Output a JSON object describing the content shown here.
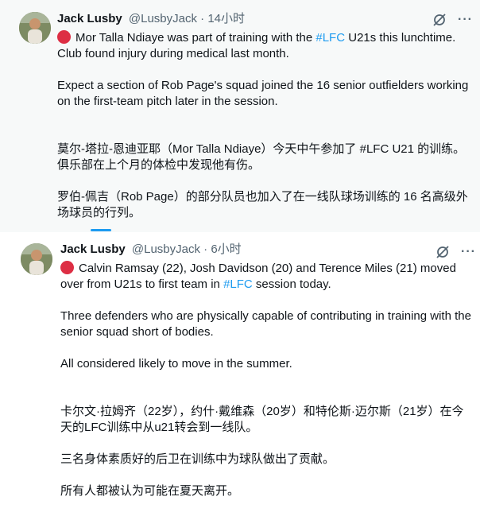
{
  "tweets": [
    {
      "author_name": "Jack Lusby",
      "author_handle": "@LusbyJack",
      "separator": "·",
      "time": "14小时",
      "lead_pre": "Mor Talla Ndiaye was part of training with the ",
      "hashtag": "#LFC",
      "lead_post": " U21s this lunchtime.",
      "line2": "Club found injury during medical last month.",
      "para2": "Expect a section of Rob Page's squad joined the 16 senior outfielders working on the first-team pitch later in the session.",
      "para3": "莫尔-塔拉-恩迪亚耶（Mor Talla Ndiaye）今天中午参加了 #LFC U21 的训练。俱乐部在上个月的体检中发现他有伤。",
      "para4": "罗伯-佩吉（Rob Page）的部分队员也加入了在一线队球场训练的 16 名高级外场球员的行列。"
    },
    {
      "author_name": "Jack Lusby",
      "author_handle": "@LusbyJack",
      "separator": "·",
      "time": "6小时",
      "lead_pre": "Calvin Ramsay (22), Josh Davidson (20) and Terence Miles (21) moved over from U21s to first team in ",
      "hashtag": "#LFC",
      "lead_post": " session today.",
      "para2": "Three defenders who are physically capable of contributing in training with the senior squad short of bodies.",
      "para3": "All considered likely to move in the summer.",
      "para4": "卡尔文·拉姆齐（22岁），约什·戴维森（20岁）和特伦斯·迈尔斯（21岁）在今天的LFC训练中从u21转会到一线队。",
      "para5": "三名身体素质好的后卫在训练中为球队做出了贡献。",
      "para6": "所有人都被认为可能在夏天离开。"
    }
  ],
  "icons": {
    "grok": "grok-icon",
    "more": "more-icon",
    "red_circle": "red-circle-icon"
  },
  "colors": {
    "link": "#1d9bf0",
    "secondary_text": "#536471",
    "red_circle": "#dd2e44",
    "highlight_bg": "#f7f9f9"
  }
}
